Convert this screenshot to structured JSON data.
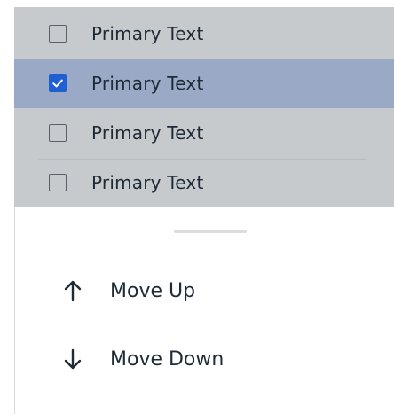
{
  "list": {
    "items": [
      {
        "label": "Primary Text",
        "checked": false,
        "selected": false
      },
      {
        "label": "Primary Text",
        "checked": true,
        "selected": true
      },
      {
        "label": "Primary Text",
        "checked": false,
        "selected": false
      },
      {
        "label": "Primary Text",
        "checked": false,
        "selected": false
      }
    ]
  },
  "sheet": {
    "actions": [
      {
        "label": "Move Up",
        "icon": "arrow-up-icon"
      },
      {
        "label": "Move Down",
        "icon": "arrow-down-icon"
      }
    ]
  },
  "colors": {
    "list_background": "#c7cacd",
    "selected_row": "#9aa9c6",
    "checkbox_checked": "#1f5fd1",
    "text": "#1e2a36"
  }
}
